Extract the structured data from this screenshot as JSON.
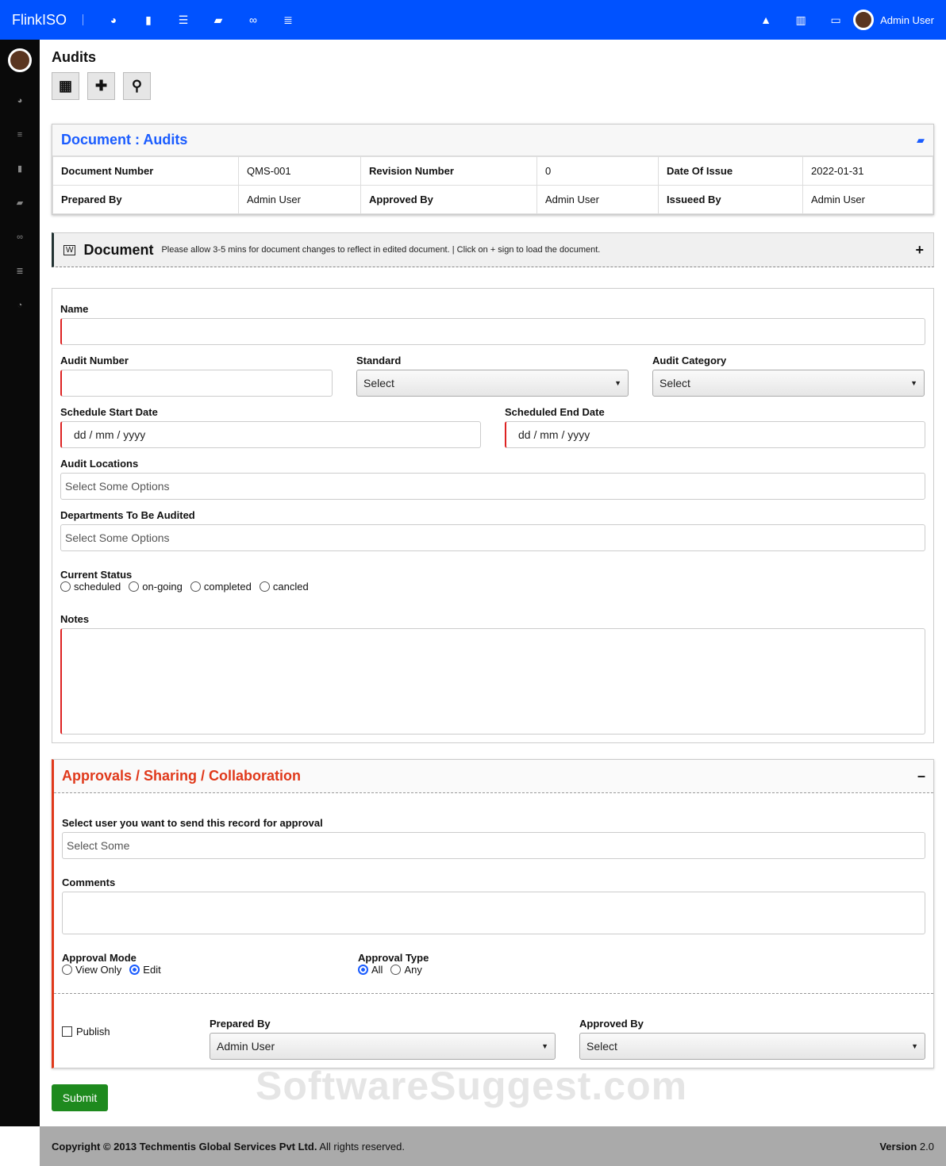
{
  "topbar": {
    "brand": "FlinkISO",
    "user": "Admin User",
    "icons": [
      "dashboard-icon",
      "bookmark-icon",
      "list-icon",
      "folder-open-icon",
      "link-icon",
      "database-icon"
    ],
    "right_icons": [
      "graduation-cap-icon",
      "bar-chart-icon",
      "credit-card-icon"
    ]
  },
  "sidebar": {
    "icons": [
      "dashboard-icon",
      "server-icon",
      "bookmark-icon",
      "folder-open-icon",
      "link-icon",
      "database-icon",
      "pie-chart-icon"
    ]
  },
  "page": {
    "title": "Audits"
  },
  "doc_panel": {
    "title": "Document : Audits",
    "rows": [
      [
        "Document Number",
        "QMS-001",
        "Revision Number",
        "0",
        "Date Of Issue",
        "2022-01-31"
      ],
      [
        "Prepared By",
        "Admin User",
        "Approved By",
        "Admin User",
        "Issueed By",
        "Admin User"
      ]
    ]
  },
  "doc_bar": {
    "title": "Document",
    "message": "Please allow 3-5 mins for document changes to reflect in edited document. | Click on + sign to load the document.",
    "plus": "+"
  },
  "form": {
    "name_label": "Name",
    "audit_number_label": "Audit Number",
    "standard_label": "Standard",
    "standard_value": "Select",
    "category_label": "Audit Category",
    "category_value": "Select",
    "start_label": "Schedule Start Date",
    "start_placeholder": "dd / mm / yyyy",
    "end_label": "Scheduled End Date",
    "end_placeholder": "dd / mm / yyyy",
    "locations_label": "Audit Locations",
    "locations_placeholder": "Select Some Options",
    "departments_label": "Departments To Be Audited",
    "departments_placeholder": "Select Some Options",
    "status_label": "Current Status",
    "status_options": [
      "scheduled",
      "on-going",
      "completed",
      "cancled"
    ],
    "notes_label": "Notes"
  },
  "approvals": {
    "title": "Approvals / Sharing / Collaboration",
    "user_label": "Select user you want to send this record for approval",
    "user_placeholder": "Select Some",
    "comments_label": "Comments",
    "mode_label": "Approval Mode",
    "mode_options": [
      "View Only",
      "Edit"
    ],
    "mode_selected": "Edit",
    "type_label": "Approval Type",
    "type_options": [
      "All",
      "Any"
    ],
    "type_selected": "All",
    "publish_label": "Publish",
    "prepared_label": "Prepared By",
    "prepared_value": "Admin User",
    "approved_label": "Approved By",
    "approved_value": "Select"
  },
  "submit": "Submit",
  "footer": {
    "copyright_bold": "Copyright © 2013 Techmentis Global Services Pvt Ltd.",
    "copyright_rest": " All rights reserved.",
    "version_label": "Version",
    "version": "2.0"
  },
  "watermark": "SoftwareSuggest.com"
}
